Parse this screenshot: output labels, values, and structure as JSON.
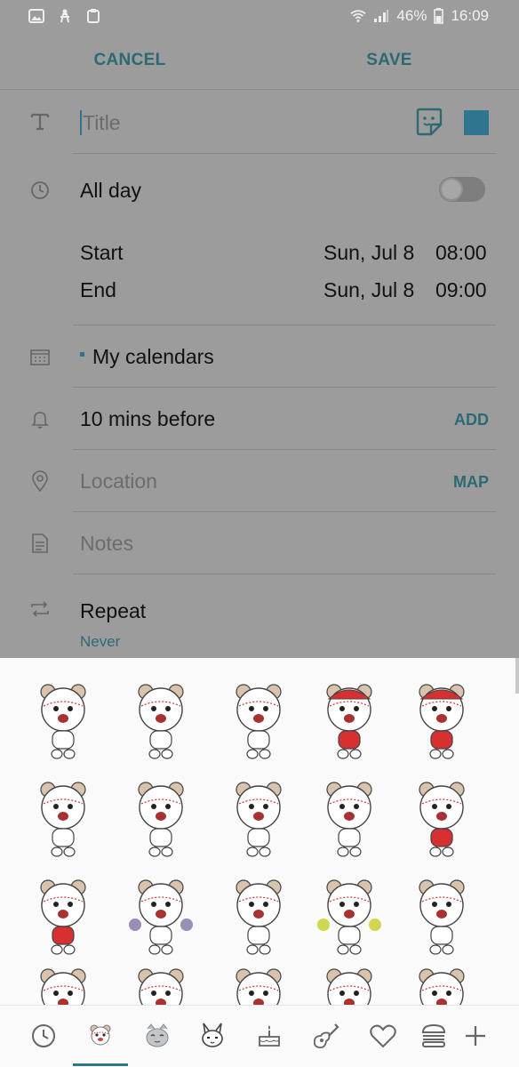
{
  "status_bar": {
    "battery": "46%",
    "time": "16:09"
  },
  "action_bar": {
    "cancel_label": "CANCEL",
    "save_label": "SAVE"
  },
  "form": {
    "title_placeholder": "Title",
    "all_day_label": "All day",
    "all_day_on": false,
    "start_label": "Start",
    "start_date": "Sun, Jul 8",
    "start_time": "08:00",
    "end_label": "End",
    "end_date": "Sun, Jul 8",
    "end_time": "09:00",
    "calendar_label": "My calendars",
    "reminder_label": "10 mins before",
    "reminder_action": "ADD",
    "location_placeholder": "Location",
    "location_action": "MAP",
    "notes_placeholder": "Notes",
    "repeat_label": "Repeat",
    "repeat_value": "Never"
  },
  "colors": {
    "accent": "#2c6a73",
    "calendar_color": "#2f7590",
    "overlay": "#9c9c9c",
    "sheet": "#fafafa"
  },
  "sticker_panel": {
    "stickers": [
      "bear-waving",
      "bear-chef",
      "bear-pair-laughing",
      "bear-red-cap",
      "bear-red-cap-cheering",
      "bear-angry-burst",
      "bear-laughing",
      "bear-jumping",
      "bear-grinning",
      "bear-dancing",
      "bear-crying",
      "bear-shocked-gloom",
      "bear-rolling-laughing",
      "bear-pompoms",
      "bear-sneaking",
      "bear-winking",
      "bear-teary",
      "bear-christmas-tree",
      "bear-reindeer",
      "bear-hearts"
    ],
    "tabs": [
      "recent-icon",
      "bear-pack-icon",
      "cat-pack-icon",
      "bunny-pack-icon",
      "cake-pack-icon",
      "guitar-pack-icon",
      "heart-pack-icon",
      "burger-pack-icon",
      "add-icon"
    ],
    "active_tab": 1
  }
}
